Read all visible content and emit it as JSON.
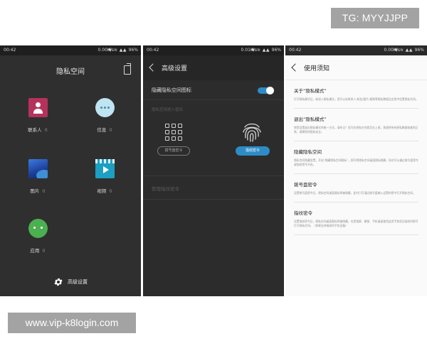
{
  "watermark": {
    "telegram": "TG: MYYJJPP",
    "url": "www.vip-k8login.com"
  },
  "status": {
    "time": "00:42",
    "left_speed": "0.00K/s",
    "mid_speed": "0.01K/s",
    "right_speed": "0.00K/s",
    "battery": "96%"
  },
  "screen1": {
    "title": "隐私空间",
    "apps": [
      {
        "label": "联系人",
        "count": "0",
        "icon": "contacts-icon"
      },
      {
        "label": "信息",
        "count": "0",
        "icon": "message-icon"
      },
      {
        "label": "图片",
        "count": "0",
        "icon": "photo-icon"
      },
      {
        "label": "视频",
        "count": "0",
        "icon": "video-icon"
      },
      {
        "label": "应用",
        "count": "0",
        "icon": "android-icon"
      }
    ],
    "advanced": "高级设置"
  },
  "screen2": {
    "title": "高级设置",
    "hide_icon_label": "隐藏隐私空间图标",
    "hide_icon_on": true,
    "section_caption": "隐私空间进入密码",
    "pattern_btn": "拨号盘密令",
    "fingerprint_btn": "指纹密令",
    "fingerprint_setting": "管理指纹密令"
  },
  "screen3": {
    "title": "使用须知",
    "items": [
      {
        "q": "关于“隐私模式”",
        "a": "打开隐私模式后，新进入隐私模式，您可以在联系人/短信/图片/视频等隐私数据及应用中设置隐私空间。"
      },
      {
        "q": "退出“隐私模式”",
        "a": "除您设置退出隐私模式的唯一方式，请牢记！您可在隐私空间首页右上角，直接将所有隐私数据恢复到正常，保障您的隐私安全。"
      },
      {
        "q": "隐藏隐私空间",
        "a": "隐私空间隐藏设置，开启“隐藏隐私空间图标”，即可将隐私空间桌面图标隐藏，如对可以通过拨号盘密令或指纹密令开启。"
      },
      {
        "q": "拨号盘密令",
        "a": "设置拨号盘密令后，隐私空间桌面图标将被隐藏，此时只可通过拨号盘输入设置的密令打开隐私空间。"
      },
      {
        "q": "指纹密令",
        "a": "设置指纹密令后，隐私空间桌面图标将被隐藏，在您锁屏、解锁、手机桌面使用这类手势验证指纹时即可打开隐私空间。（如果支持指纹的手机设备）"
      },
      {
        "q": "",
        "a": ""
      }
    ]
  }
}
